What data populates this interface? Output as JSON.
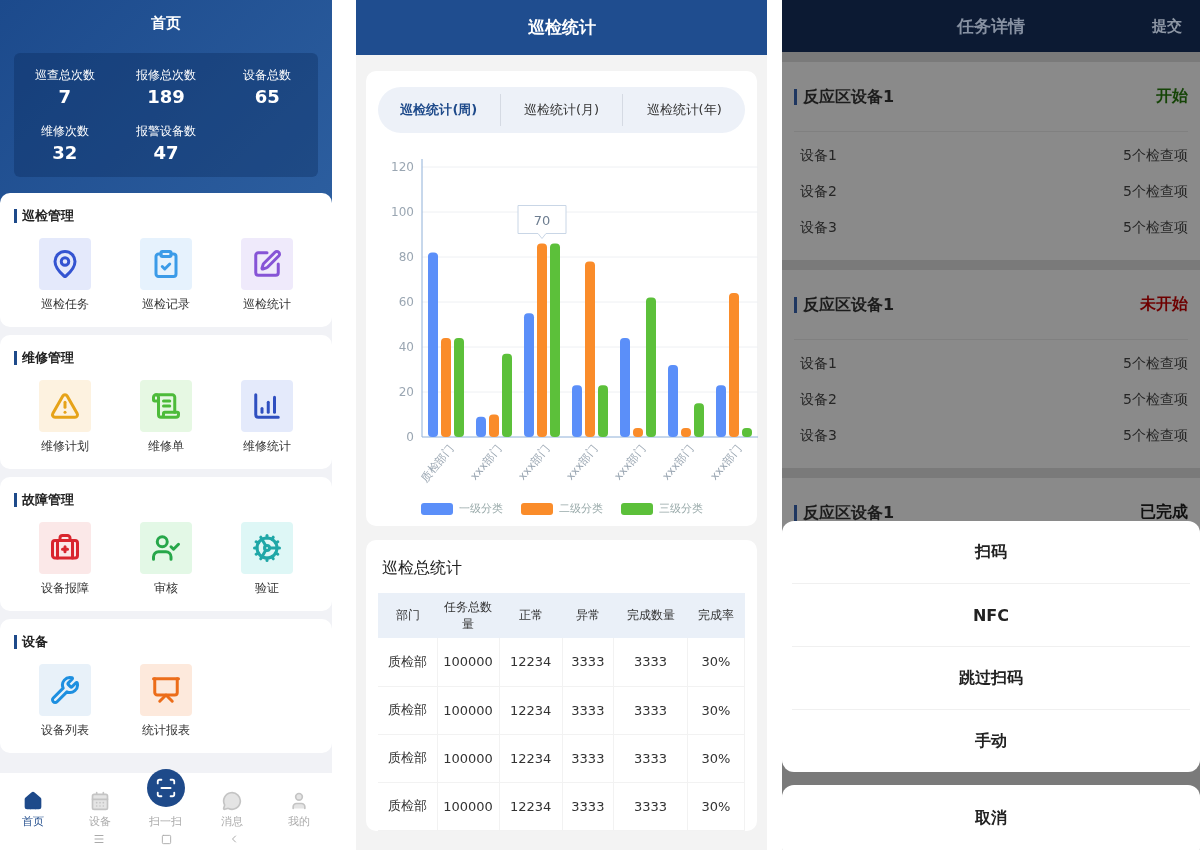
{
  "home": {
    "title": "首页",
    "stats": [
      {
        "label": "巡查总次数",
        "value": "7"
      },
      {
        "label": "报修总次数",
        "value": "189"
      },
      {
        "label": "设备总数",
        "value": "65"
      },
      {
        "label": "维修次数",
        "value": "32"
      },
      {
        "label": "报警设备数",
        "value": "47"
      }
    ],
    "sections": [
      {
        "title": "巡检管理",
        "items": [
          "巡检任务",
          "巡检记录",
          "巡检统计"
        ]
      },
      {
        "title": "维修管理",
        "items": [
          "维修计划",
          "维修单",
          "维修统计"
        ]
      },
      {
        "title": "故障管理",
        "items": [
          "设备报障",
          "审核",
          "验证"
        ]
      },
      {
        "title": "设备",
        "items": [
          "设备列表",
          "统计报表"
        ]
      }
    ],
    "tab_bar": [
      {
        "label": "首页",
        "kind": "tab",
        "selected": true
      },
      {
        "label": "设备",
        "kind": "tab",
        "selected": false
      },
      {
        "label": "扫一扫",
        "kind": "scan",
        "selected": false
      },
      {
        "label": "消息",
        "kind": "tab",
        "selected": false
      },
      {
        "label": "我的",
        "kind": "tab",
        "selected": false
      }
    ]
  },
  "inspection_stats": {
    "title": "巡检统计",
    "tabs": [
      {
        "label": "巡检统计(周)",
        "selected": true
      },
      {
        "label": "巡检统计(月)",
        "selected": false
      },
      {
        "label": "巡检统计(年)",
        "selected": false
      }
    ],
    "chart_data": {
      "type": "bar",
      "categories": [
        "质检部门",
        "xxx部门",
        "xxx部门",
        "xxx部门",
        "xxx部门",
        "xxx部门",
        "xxx部门"
      ],
      "ylim": [
        0,
        120
      ],
      "yticks": [
        0,
        20,
        40,
        60,
        80,
        100,
        120
      ],
      "series": [
        {
          "name": "一级分类",
          "color": "#5b8ff9",
          "values": [
            82,
            9,
            55,
            23,
            44,
            32,
            23
          ]
        },
        {
          "name": "二级分类",
          "color": "#fa8c2a",
          "values": [
            44,
            10,
            86,
            78,
            4,
            4,
            64
          ]
        },
        {
          "name": "三级分类",
          "color": "#5cc03a",
          "values": [
            44,
            37,
            86,
            23,
            62,
            15,
            4
          ]
        }
      ],
      "grid": true,
      "annotations": [
        "70"
      ]
    },
    "table": {
      "title": "巡检总统计",
      "columns": [
        "部门",
        "任务总数量",
        "正常",
        "异常",
        "完成数量",
        "完成率"
      ],
      "rows": [
        [
          "质检部",
          "100000",
          "12234",
          "3333",
          "3333",
          "30%"
        ],
        [
          "质检部",
          "100000",
          "12234",
          "3333",
          "3333",
          "30%"
        ],
        [
          "质检部",
          "100000",
          "12234",
          "3333",
          "3333",
          "30%"
        ],
        [
          "质检部",
          "100000",
          "12234",
          "3333",
          "3333",
          "30%"
        ]
      ]
    }
  },
  "task_detail": {
    "title": "任务详情",
    "action": "提交",
    "groups": [
      {
        "name": "反应区设备1",
        "status": "开始",
        "color": "#154407",
        "rows": [
          {
            "name": "设备1",
            "value": "5个检查项"
          },
          {
            "name": "设备2",
            "value": "5个检查项"
          },
          {
            "name": "设备3",
            "value": "5个检查项"
          }
        ]
      },
      {
        "name": "反应区设备1",
        "status": "未开始",
        "color": "#6e0000",
        "rows": [
          {
            "name": "设备1",
            "value": "5个检查项"
          },
          {
            "name": "设备2",
            "value": "5个检查项"
          },
          {
            "name": "设备3",
            "value": "5个检查项"
          }
        ]
      },
      {
        "name": "反应区设备1",
        "status": "已完成",
        "color": "#111111"
      }
    ],
    "action_sheet": {
      "options": [
        "扫码",
        "NFC",
        "跳过扫码",
        "手动"
      ],
      "cancel": "取消"
    }
  }
}
